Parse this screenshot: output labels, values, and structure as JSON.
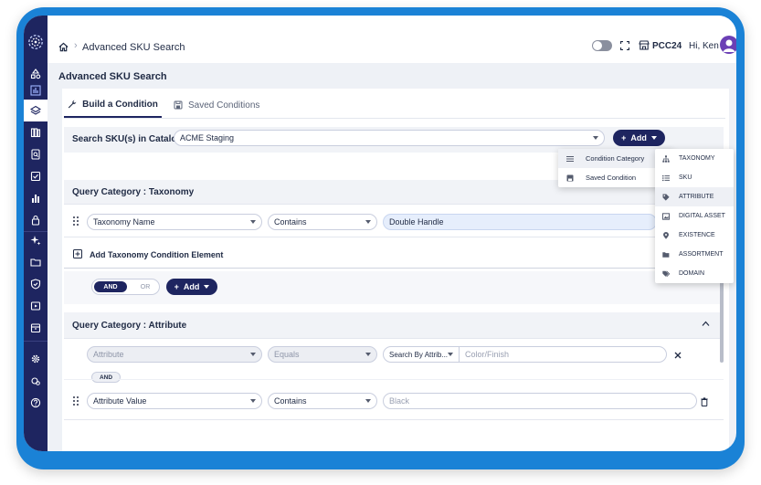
{
  "app": {
    "breadcrumb": "Advanced SKU Search",
    "store": "PCC24",
    "greeting": "Hi, Ken",
    "page_title": "Advanced SKU Search"
  },
  "tabs": [
    {
      "label": "Build a Condition",
      "active": true
    },
    {
      "label": "Saved Conditions",
      "active": false
    }
  ],
  "catalog": {
    "label": "Search SKU(s) in Catalog",
    "value": "ACME Staging",
    "add_label": "Add"
  },
  "taxonomy": {
    "title": "Query Category : Taxonomy",
    "field": "Taxonomy Name",
    "operator": "Contains",
    "value": "Double Handle",
    "add_element": "Add Taxonomy Condition Element"
  },
  "logic": {
    "and": "AND",
    "or": "OR",
    "add_label": "Add"
  },
  "attribute": {
    "title": "Query Category : Attribute",
    "row1": {
      "field": "Attribute",
      "operator": "Equals",
      "search_by": "Search By Attrib...",
      "placeholder": "Color/Finish"
    },
    "chip": "AND",
    "row2": {
      "field": "Attribute Value",
      "operator": "Contains",
      "placeholder": "Black"
    }
  },
  "add_menu": {
    "items": [
      "Condition Category",
      "Saved Condition"
    ]
  },
  "category_menu": {
    "items": [
      "TAXONOMY",
      "SKU",
      "ATTRIBUTE",
      "DIGITAL ASSET",
      "EXISTENCE",
      "ASSORTMENT",
      "DOMAIN"
    ],
    "highlighted": "ATTRIBUTE"
  },
  "colors": {
    "frame": "#1a82d6",
    "rail": "#1e2560",
    "accent": "#1e2560",
    "avatar": "#6b3fb5"
  }
}
